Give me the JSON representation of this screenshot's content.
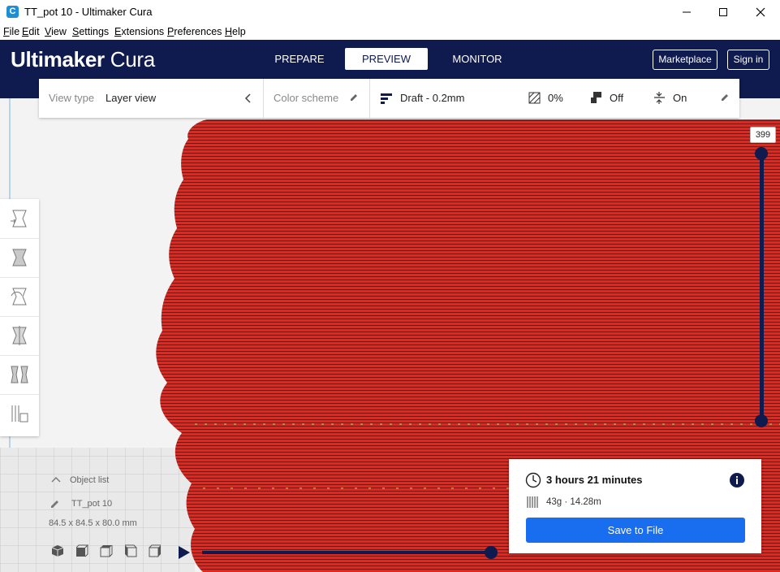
{
  "window": {
    "title": "TT_pot 10 - Ultimaker Cura",
    "app_icon_letter": "C"
  },
  "menu": [
    "File",
    "Edit",
    "View",
    "Settings",
    "Extensions",
    "Preferences",
    "Help"
  ],
  "header": {
    "logo_bold": "Ultimaker",
    "logo_light": " Cura",
    "stages": [
      {
        "label": "PREPARE",
        "active": false
      },
      {
        "label": "PREVIEW",
        "active": true
      },
      {
        "label": "MONITOR",
        "active": false
      }
    ],
    "marketplace_label": "Marketplace",
    "signin_label": "Sign in"
  },
  "toolbar": {
    "view_type_label": "View type",
    "view_type_value": "Layer view",
    "color_scheme_label": "Color scheme",
    "profile": "Draft - 0.2mm",
    "infill": "0%",
    "support": "Off",
    "adhesion": "On"
  },
  "layer_slider": {
    "current_layer": "399"
  },
  "object_list": {
    "label": "Object list",
    "object_name": "TT_pot 10",
    "dimensions": "84.5 x 84.5 x 80.0 mm"
  },
  "print_info": {
    "time": "3 hours 21 minutes",
    "material": "43g · 14.28m",
    "save_label": "Save to File"
  },
  "colors": {
    "header_bg": "#0f1a4f",
    "model_red": "#e8251c",
    "accent_blue": "#196ef0"
  }
}
